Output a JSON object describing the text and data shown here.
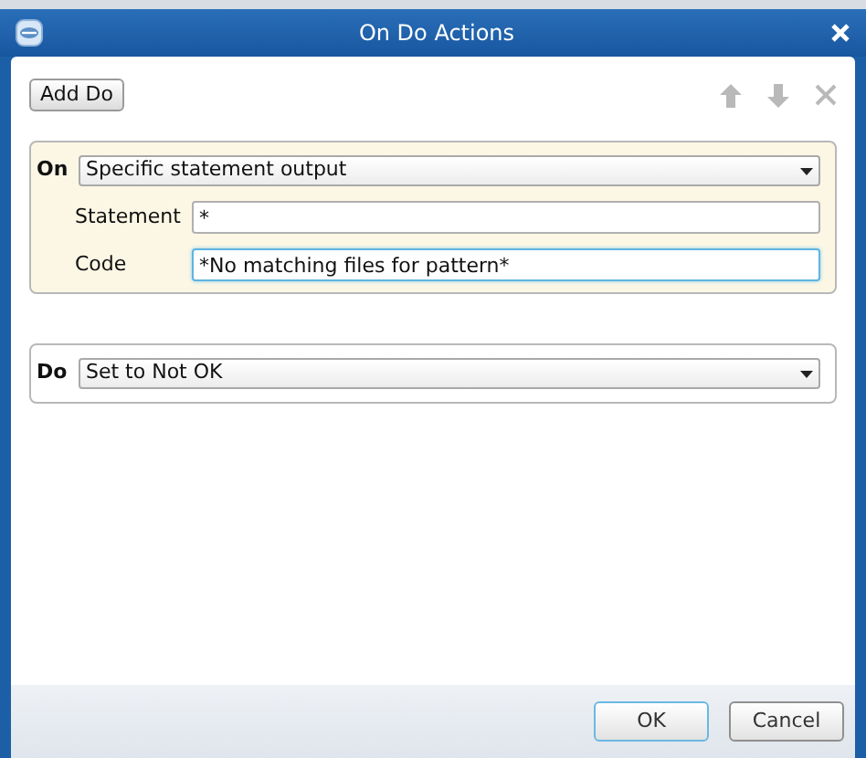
{
  "window": {
    "title": "On Do Actions"
  },
  "toolbar": {
    "add_button": "Add Do",
    "move_up": {
      "disabled": true
    },
    "move_down": {
      "disabled": true
    },
    "delete": {
      "disabled": true
    }
  },
  "on_section": {
    "label": "On",
    "dropdown": "Specific statement output",
    "fields": [
      {
        "label": "Statement",
        "value": "*",
        "focused": false
      },
      {
        "label": "Code",
        "value": "*No matching files for pattern*",
        "focused": true
      }
    ]
  },
  "do_section": {
    "label": "Do",
    "dropdown": "Set to Not OK"
  },
  "buttons": [
    {
      "label": "OK",
      "default": true
    },
    {
      "label": "Cancel",
      "default": false
    }
  ]
}
